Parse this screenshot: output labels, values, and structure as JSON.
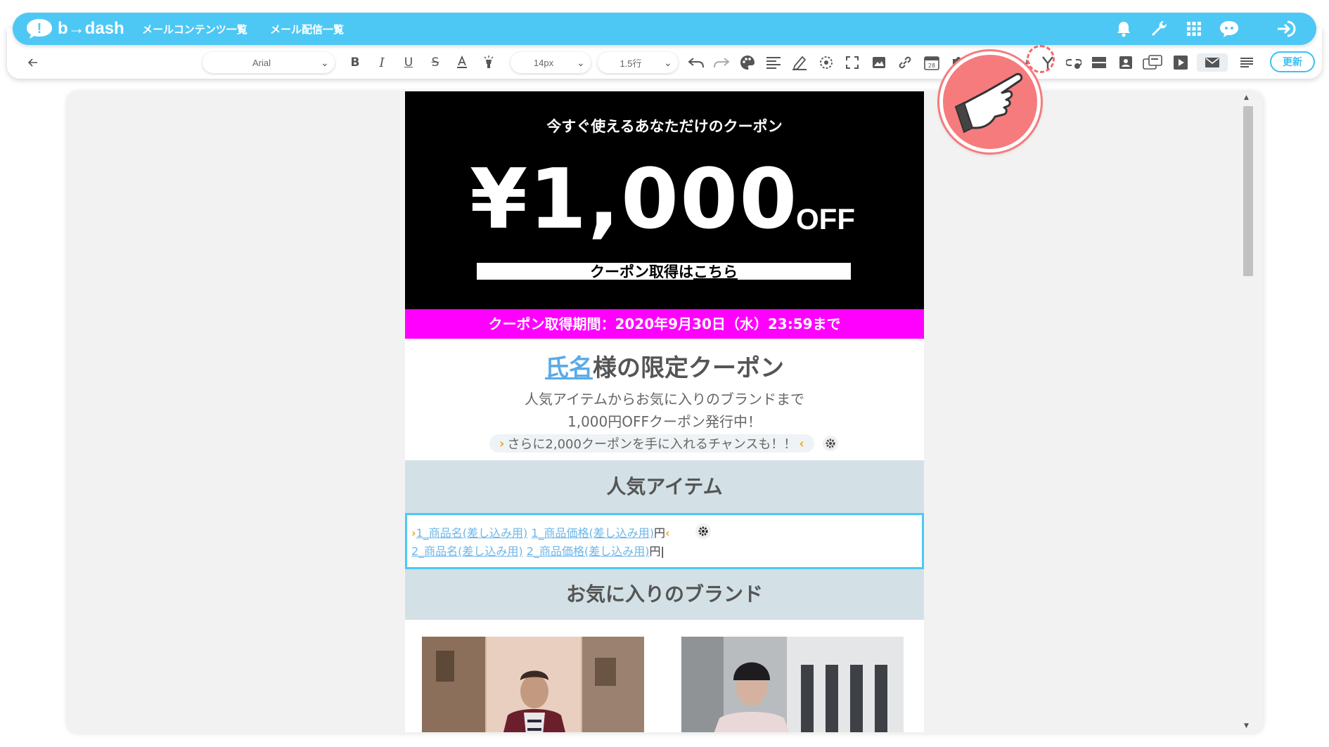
{
  "app": {
    "logo_text": "b→dash",
    "nav": [
      "メールコンテンツ一覧",
      "メール配信一覧"
    ]
  },
  "toolbar": {
    "font_family": "Arial",
    "font_size": "14px",
    "line_height": "1.5行",
    "update_label": "更新"
  },
  "email": {
    "hero_subtitle": "今すぐ使えるあなただけのクーポン",
    "hero_price": "¥1,000",
    "hero_off": "OFF",
    "coupon_button_prefix": "クーポン取得は",
    "coupon_button_link": "こちら",
    "coupon_period": "クーポン取得期間：2020年9月30日（水）23:59まで",
    "offer_name": "氏名",
    "offer_title_rest": "様の限定クーポン",
    "offer_line1": "人気アイテムからお気に入りのブランドまで",
    "offer_line2": "1,000円OFFクーポン発行中！",
    "merge_text": "さらに2,000クーポンを手に入れるチャンスも！！",
    "popular_heading": "人気アイテム",
    "item1_name": "1_商品名(差し込み用)",
    "item1_price": "1_商品価格(差し込み用)",
    "item2_name": "2_商品名(差し込み用)",
    "item2_price": "2_商品価格(差し込み用)",
    "yen": "円",
    "brand_heading": "お気に入りのブランド"
  },
  "colors": {
    "brand_blue": "#4dc8f5",
    "magenta": "#ff00ff",
    "section_bg": "#d3e1e6",
    "hint_red": "#f57b7d"
  }
}
